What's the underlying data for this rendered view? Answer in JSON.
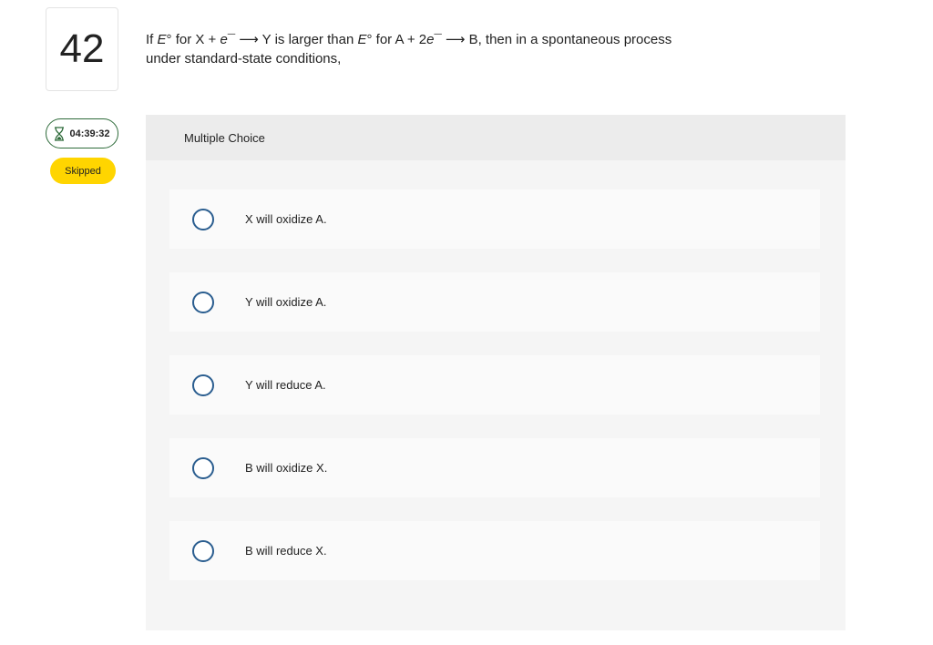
{
  "question": {
    "number": "42",
    "text_parts": {
      "p1": "If ",
      "e1": "E",
      "p2": "° for X + ",
      "e2": "e",
      "p3": "¯ ⟶ Y is larger than ",
      "e3": "E",
      "p4": "° for A + 2",
      "e4": "e",
      "p5": "¯ ⟶ B, then in a spontaneous process under standard-state conditions,"
    }
  },
  "timer": {
    "icon": "hourglass-icon",
    "value": "04:39:32"
  },
  "status_badge": "Skipped",
  "panel": {
    "header": "Multiple Choice",
    "options": [
      {
        "label": "X will oxidize A."
      },
      {
        "label": "Y will oxidize A."
      },
      {
        "label": "Y will reduce A."
      },
      {
        "label": "B will oxidize X."
      },
      {
        "label": "B will reduce X."
      }
    ]
  },
  "colors": {
    "badge_yellow": "#ffd500",
    "timer_border": "#2e6b3a",
    "radio_blue": "#2a5d8f"
  }
}
